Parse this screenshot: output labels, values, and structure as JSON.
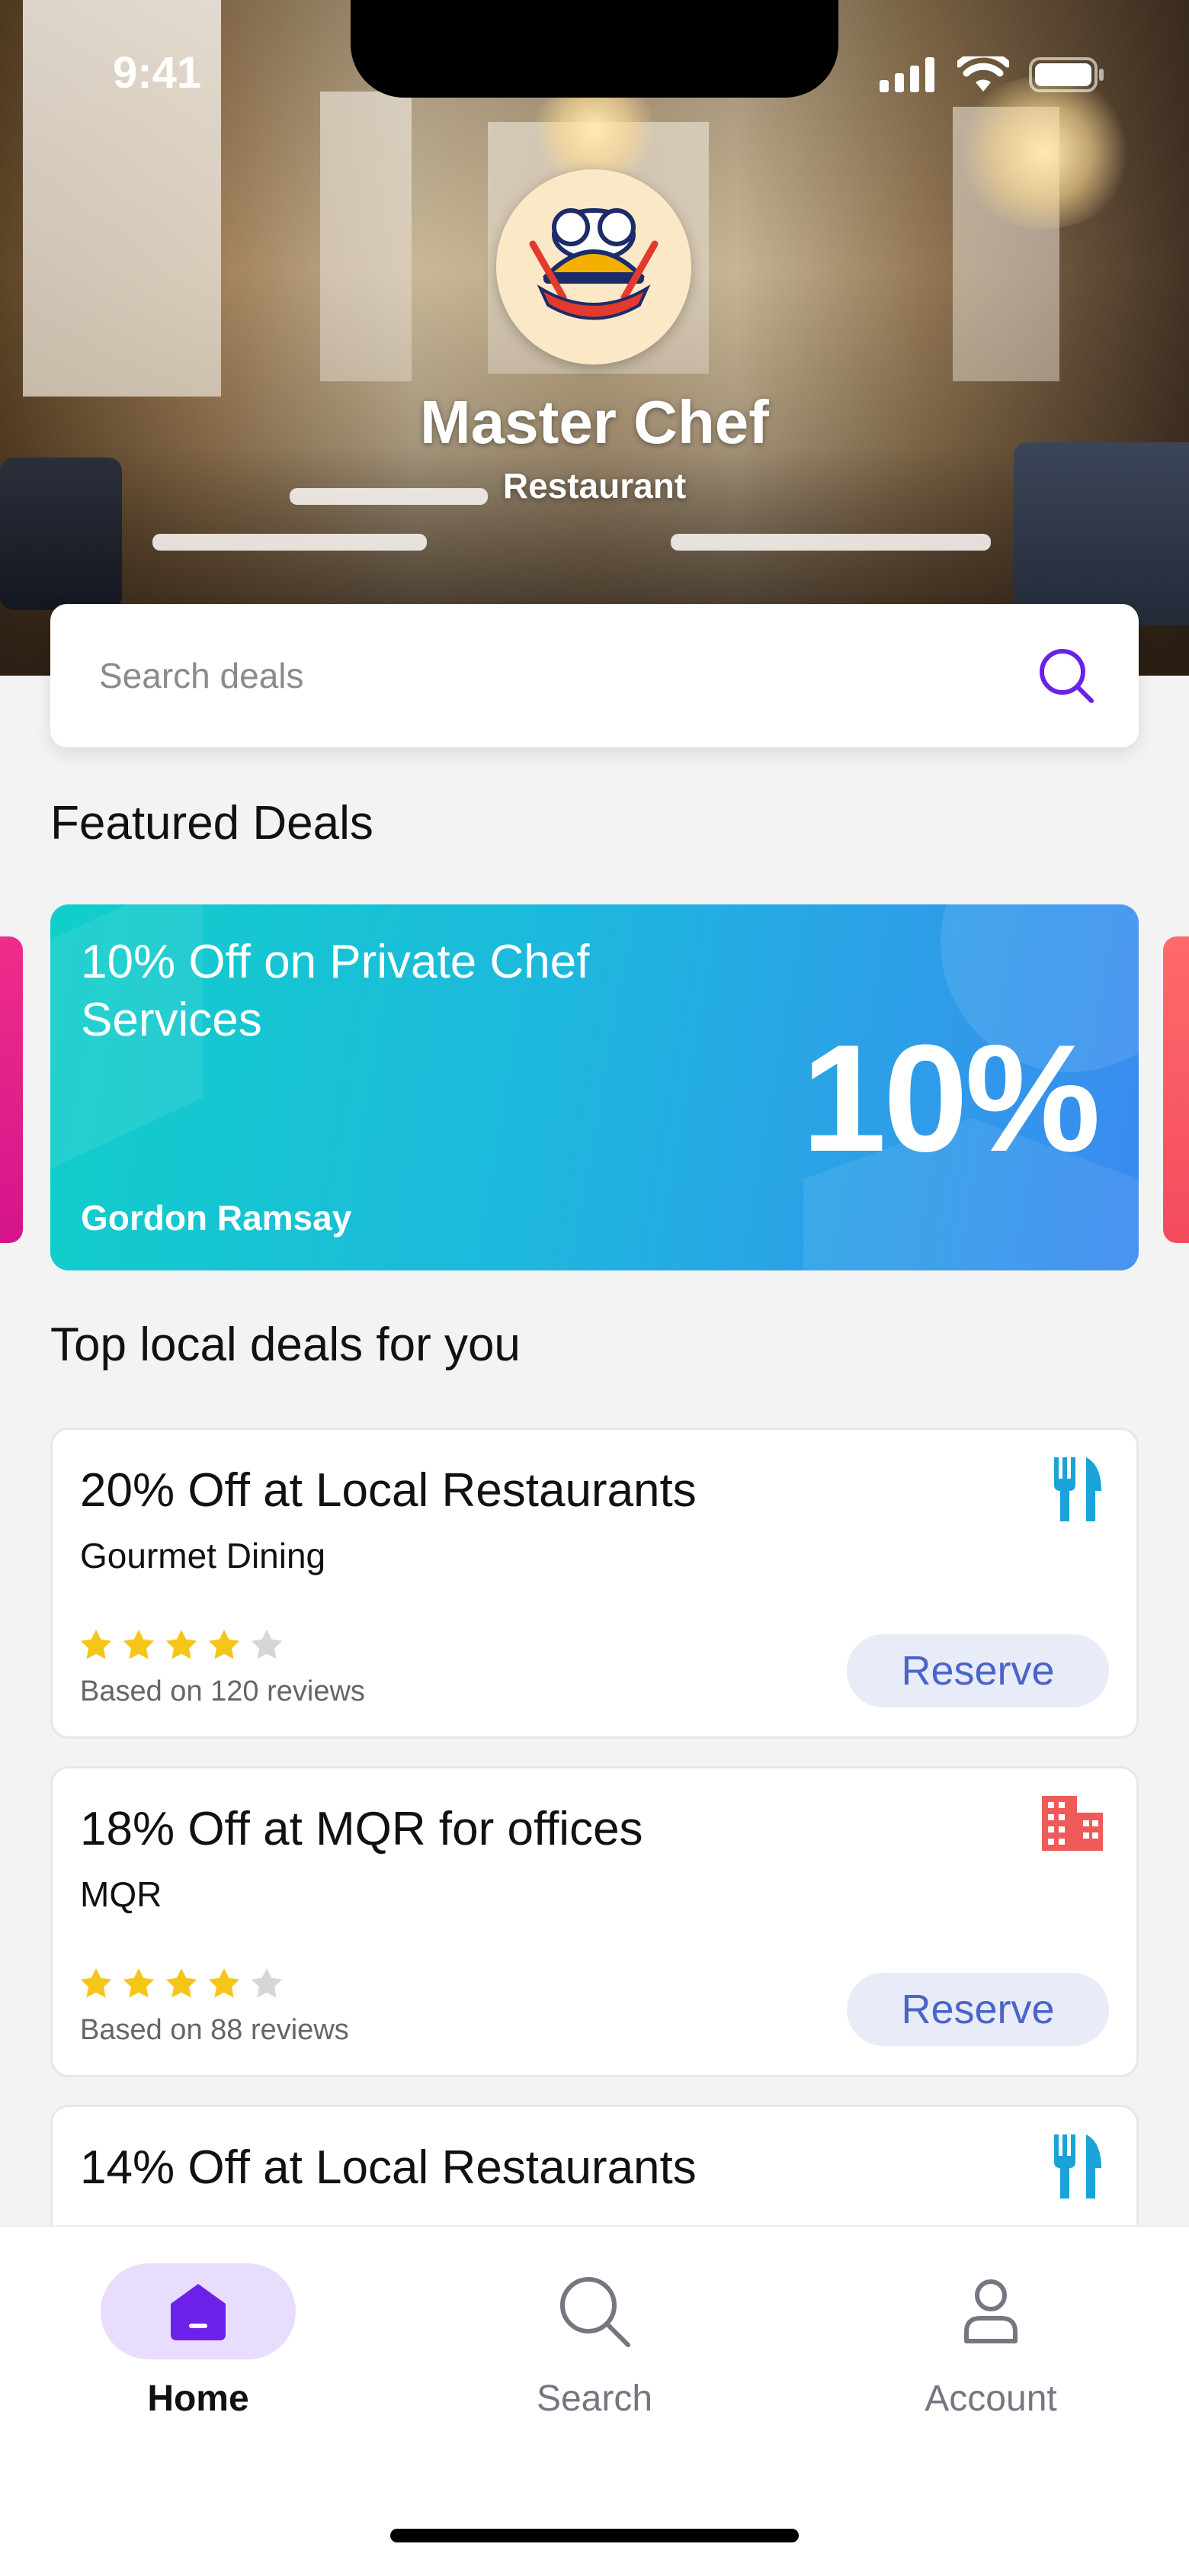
{
  "status_bar": {
    "time": "9:41"
  },
  "header": {
    "logo_text": "MASTER CHEF",
    "title": "Master Chef",
    "subtitle": "Restaurant"
  },
  "search": {
    "placeholder": "Search deals",
    "icon": "search-icon"
  },
  "featured": {
    "section_title": "Featured Deals",
    "card": {
      "title": "10% Off on Private Chef Services",
      "percent": "10%",
      "merchant": "Gordon Ramsay"
    }
  },
  "local": {
    "section_title": "Top local deals for you",
    "deals": [
      {
        "title": "20% Off at Local Restaurants",
        "merchant": "Gourmet Dining",
        "rating": 4,
        "max_rating": 5,
        "reviews": "Based on 120 reviews",
        "reserve_label": "Reserve",
        "icon": "utensils-icon",
        "icon_color": "#1aa3d9"
      },
      {
        "title": "18% Off at MQR for offices",
        "merchant": "MQR",
        "rating": 4,
        "max_rating": 5,
        "reviews": "Based on 88 reviews",
        "reserve_label": "Reserve",
        "icon": "building-icon",
        "icon_color": "#f05a5a"
      },
      {
        "title": "14% Off at Local Restaurants",
        "icon": "utensils-icon",
        "icon_color": "#1aa3d9"
      }
    ]
  },
  "tabbar": {
    "items": [
      {
        "label": "Home",
        "icon": "home-icon",
        "active": true
      },
      {
        "label": "Search",
        "icon": "search-icon",
        "active": false
      },
      {
        "label": "Account",
        "icon": "account-icon",
        "active": false
      }
    ]
  },
  "colors": {
    "accent": "#6b21e8",
    "star": "#f5c518",
    "star_empty": "#d6d6d6",
    "reserve_bg": "#e8ecf8",
    "reserve_text": "#4a64c9"
  }
}
